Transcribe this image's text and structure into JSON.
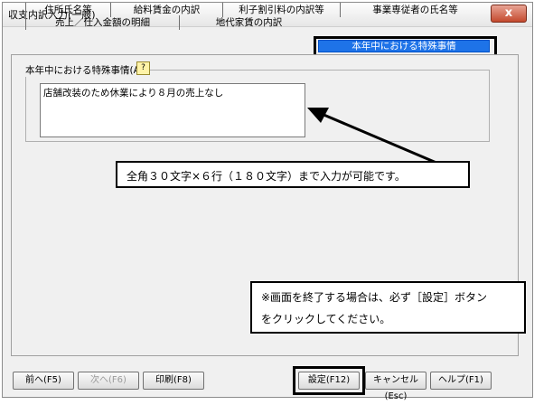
{
  "window": {
    "title": "収支内訳入力(一般)",
    "close": "x"
  },
  "tabs": {
    "row1": [
      "住所氏名等",
      "給料賃金の内訳",
      "利子割引料の内訳等",
      "事業専従者の氏名等"
    ],
    "row2": [
      "売上／仕入金額の明細",
      "地代家賃の内訳",
      "本年中における特殊事情"
    ]
  },
  "group": {
    "label": "本年中における特殊事情(A)",
    "hint_icon": "?"
  },
  "input": {
    "value": "店舗改装のため休業により８月の売上なし"
  },
  "callouts": {
    "limit": "全角３０文字×６行（１８０文字）まで入力が可能です。",
    "close_line1": "※画面を終了する場合は、必ず［設定］ボタン",
    "close_line2": "をクリックしてください。"
  },
  "buttons": {
    "prev": "前へ(F5)",
    "next": "次へ(F6)",
    "print": "印刷(F8)",
    "set": "設定(F12)",
    "cancel": "キャンセル(Esc)",
    "help": "ヘルプ(F1)"
  }
}
